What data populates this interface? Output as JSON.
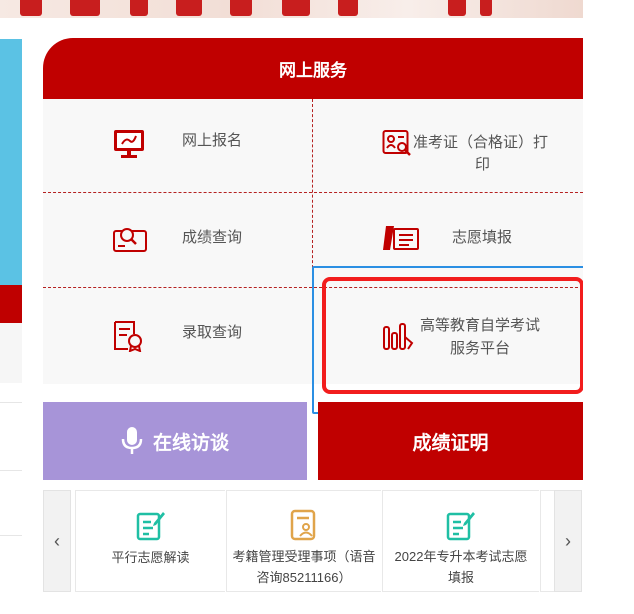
{
  "service_panel": {
    "title": "网上服务",
    "items": [
      {
        "icon": "monitor-icon",
        "label": "网上报名"
      },
      {
        "icon": "admission-ticket-print-icon",
        "label_line1": "准考证（合格证）打",
        "label_line2": "印"
      },
      {
        "icon": "score-query-icon",
        "label": "成绩查询"
      },
      {
        "icon": "application-fill-icon",
        "label": "志愿填报"
      },
      {
        "icon": "admission-query-icon",
        "label": "录取查询"
      },
      {
        "icon": "self-study-exam-icon",
        "label_line1": "高等教育自学考试",
        "label_line2": "服务平台"
      }
    ]
  },
  "buttons": {
    "interview": {
      "icon": "microphone-icon",
      "label": "在线访谈"
    },
    "score_proof": {
      "label": "成绩证明"
    }
  },
  "carousel": {
    "prev": "‹",
    "next": "›",
    "cards": [
      {
        "icon": "edit-document-icon",
        "label": "平行志愿解读"
      },
      {
        "icon": "registration-management-icon",
        "label_line1": "考籍管理受理事项（语音",
        "label_line2": "咨询85211166）"
      },
      {
        "icon": "edit-document-icon",
        "label_line1": "2022年专升本考试志愿",
        "label_line2": "填报"
      }
    ]
  },
  "colors": {
    "brand_red": "#c00000",
    "purple": "#a794d8",
    "teal_icon": "#1fbfa4",
    "gold_icon": "#e0a44a",
    "highlight_blue": "#2b8fe3",
    "highlight_red": "#f21d1d"
  }
}
